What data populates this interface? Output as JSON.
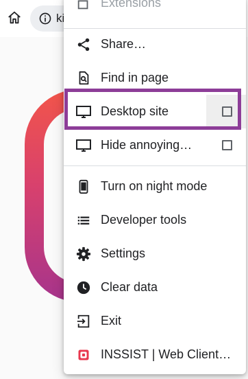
{
  "address_bar": {
    "url_fragment": "ki"
  },
  "menu": {
    "items": [
      {
        "label": "Extensions",
        "icon": "extension-icon"
      },
      {
        "label": "Share…",
        "icon": "share-icon"
      },
      {
        "label": "Find in page",
        "icon": "find-in-page-icon"
      },
      {
        "label": "Desktop site",
        "icon": "desktop-icon",
        "checked": false
      },
      {
        "label": "Hide annoying…",
        "icon": "desktop-icon",
        "checked": false
      },
      {
        "label": "Turn on night mode",
        "icon": "phone-icon"
      },
      {
        "label": "Developer tools",
        "icon": "list-icon"
      },
      {
        "label": "Settings",
        "icon": "gear-icon"
      },
      {
        "label": "Clear data",
        "icon": "clock-icon"
      },
      {
        "label": "Exit",
        "icon": "exit-icon"
      },
      {
        "label": "INSSIST | Web Client…",
        "icon": "inssist-icon"
      }
    ]
  },
  "colors": {
    "highlight": "#8d3d98",
    "logo_gradient_top": "#f2554a",
    "logo_gradient_bottom": "#a6348c",
    "inssist_icon": "#e8384f"
  }
}
